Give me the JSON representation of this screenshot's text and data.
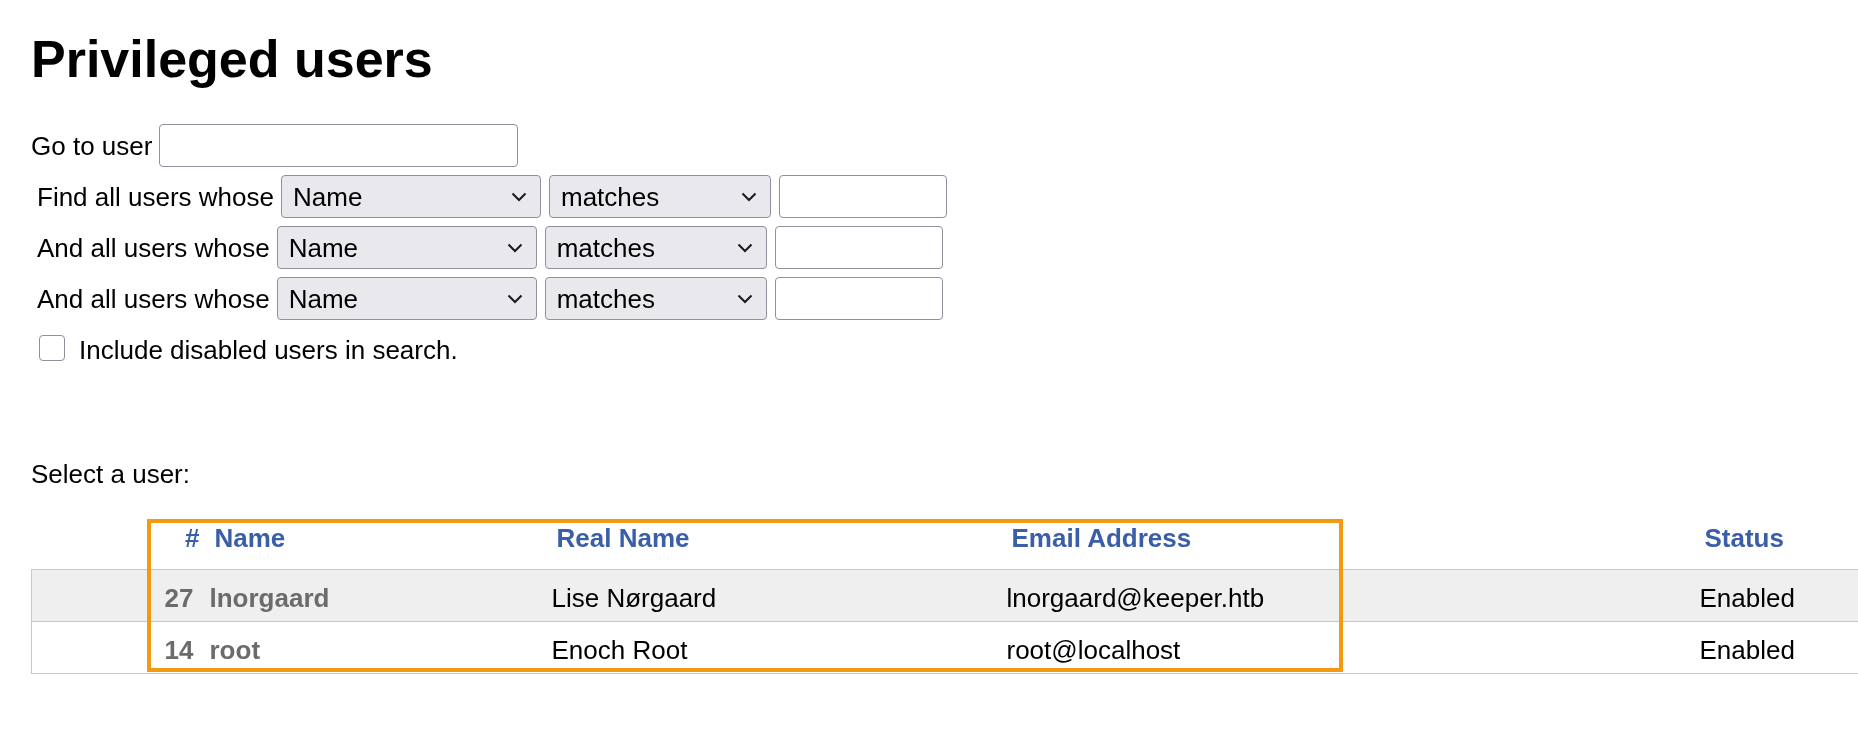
{
  "title": "Privileged users",
  "go_to_user": {
    "label": "Go to user"
  },
  "filters": [
    {
      "label": "Find all users whose",
      "field": "Name",
      "operator": "matches"
    },
    {
      "label": "And all users whose",
      "field": "Name",
      "operator": "matches"
    },
    {
      "label": "And all users whose",
      "field": "Name",
      "operator": "matches"
    }
  ],
  "include_disabled": {
    "label": "Include disabled users in search.",
    "checked": false
  },
  "select_prompt": "Select a user:",
  "table": {
    "columns": [
      "#",
      "Name",
      "Real Name",
      "Email Address",
      "Status"
    ],
    "rows": [
      {
        "id": "27",
        "name": "lnorgaard",
        "real_name": "Lise Nørgaard",
        "email": "lnorgaard@keeper.htb",
        "status": "Enabled"
      },
      {
        "id": "14",
        "name": "root",
        "real_name": "Enoch Root",
        "email": "root@localhost",
        "status": "Enabled"
      }
    ]
  }
}
